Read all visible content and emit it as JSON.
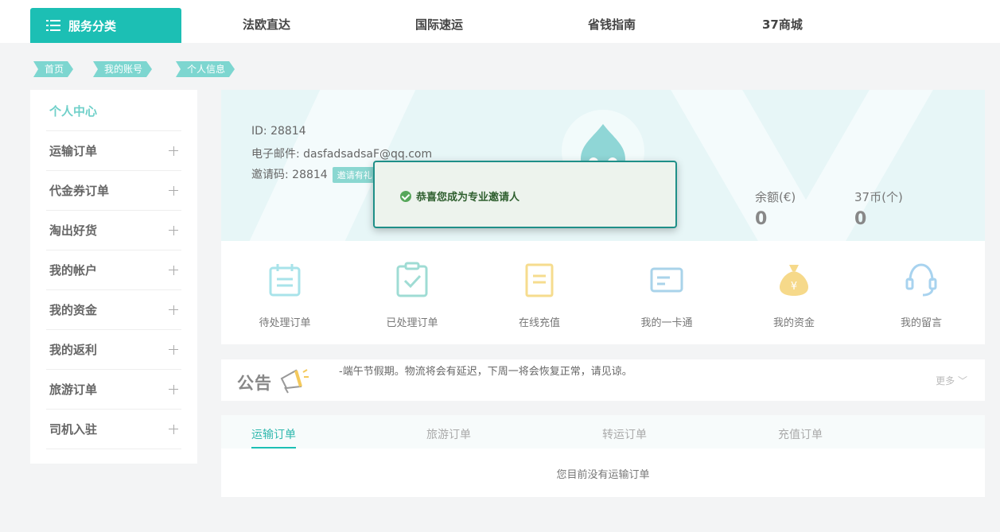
{
  "topnav": {
    "service_label": "服务分类",
    "items": [
      "法欧直达",
      "国际速运",
      "省钱指南",
      "37商城"
    ]
  },
  "breadcrumb": [
    "首页",
    "我的账号",
    "个人信息"
  ],
  "sidebar": {
    "title": "个人中心",
    "items": [
      "运输订单",
      "代金券订单",
      "淘出好货",
      "我的帐户",
      "我的资金",
      "我的返利",
      "旅游订单",
      "司机入驻"
    ]
  },
  "profile": {
    "id_line": "ID: 28814",
    "email_line": "电子邮件: dasfadsadsaF@qq.com",
    "invite_line": "邀请码: 28814",
    "invite_badge": "邀请有礼"
  },
  "balances": [
    {
      "label": "余额(€)",
      "value": "0"
    },
    {
      "label": "37币(个)",
      "value": "0"
    }
  ],
  "quick_links": [
    {
      "label": "待处理订单",
      "icon": "calendar-icon",
      "color": "#a8e3ea"
    },
    {
      "label": "已处理订单",
      "icon": "clipboard-check-icon",
      "color": "#9fdcd4"
    },
    {
      "label": "在线充值",
      "icon": "document-icon",
      "color": "#f6dc8e"
    },
    {
      "label": "我的一卡通",
      "icon": "card-icon",
      "color": "#a9d3ea"
    },
    {
      "label": "我的资金",
      "icon": "money-bag-icon",
      "color": "#f6d98a"
    },
    {
      "label": "我的留言",
      "icon": "headset-icon",
      "color": "#a8d3ef"
    }
  ],
  "notice": {
    "title": "公告",
    "ticker": "-端午节假期。物流将会有延迟，下周一将会恢复正常，请见谅。",
    "more": "更多"
  },
  "orders": {
    "tabs": [
      "运输订单",
      "旅游订单",
      "转运订单",
      "充值订单"
    ],
    "empty_message": "您目前没有运输订单"
  },
  "toast": {
    "message": "恭喜您成为专业邀请人"
  },
  "colors": {
    "accent": "#1cbfb4",
    "banner_bg": "#e7f6f7",
    "page_bg": "#f3f4f5"
  }
}
